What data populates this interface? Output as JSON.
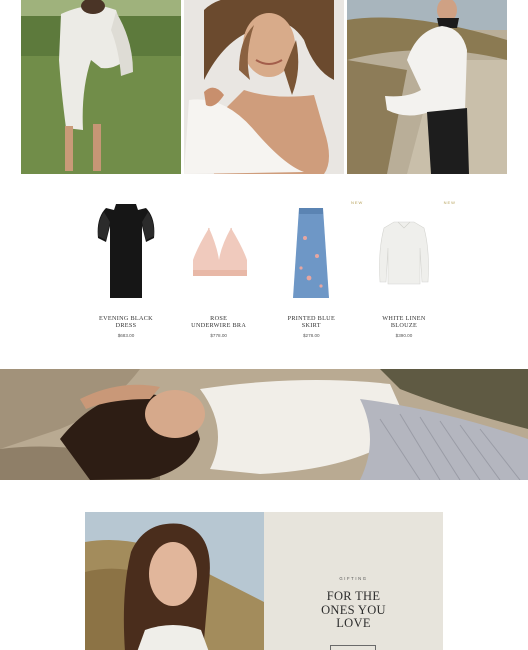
{
  "products": [
    {
      "name": "EVENING BLACK\nDRESS",
      "price": "$683.00",
      "badge": ""
    },
    {
      "name": "ROSE\nUNDERWIRE BRA",
      "price": "$778.00",
      "badge": ""
    },
    {
      "name": "PRINTED BLUE\nSKIRT",
      "price": "$278.00",
      "badge": "NEW"
    },
    {
      "name": "WHITE LINEN\nBLOUZE",
      "price": "$390.00",
      "badge": "NEW"
    }
  ],
  "gifting": {
    "kicker": "GIFTING",
    "headline": "FOR THE\nONES YOU\nLOVE"
  },
  "colors": {
    "accent_gold": "#b6a15a",
    "panel_beige": "#e7e4dc",
    "text_dark": "#2a2a2a"
  }
}
